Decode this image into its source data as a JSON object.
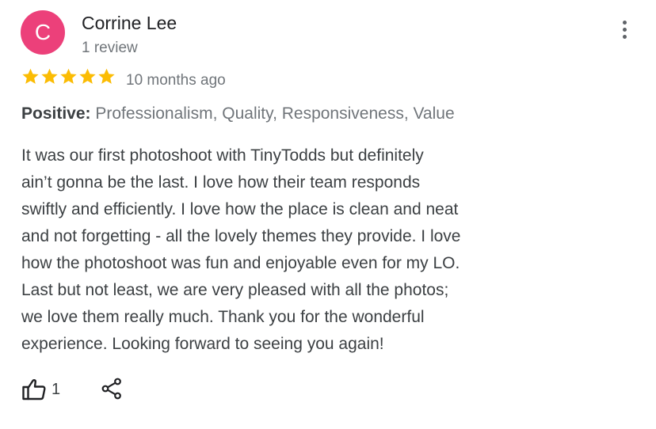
{
  "reviewer": {
    "avatar_initial": "C",
    "avatar_color": "#ec407a",
    "name": "Corrine Lee",
    "review_count": "1 review"
  },
  "menu": {
    "icon": "more-vert-icon"
  },
  "rating": {
    "stars": 5,
    "max_stars": 5,
    "star_color": "#fbbc04",
    "time_ago": "10 months ago"
  },
  "positive": {
    "label": "Positive:",
    "values": "Professionalism, Quality, Responsiveness, Value"
  },
  "review": {
    "lines": [
      "It was our first photoshoot with TinyTodds but definitely",
      "ain’t gonna be the last. I love how their team responds",
      "swiftly and efficiently. I love how the place is clean and neat",
      "and not forgetting - all the lovely themes they provide. I love",
      "how the photoshoot was fun and enjoyable even for my LO.",
      "Last but not least, we are very pleased with all the photos;",
      "we love them really much. Thank you for the wonderful",
      "experience. Looking forward to seeing you again!"
    ]
  },
  "actions": {
    "like_icon": "thumbs-up-icon",
    "like_count": "1",
    "share_icon": "share-icon"
  }
}
